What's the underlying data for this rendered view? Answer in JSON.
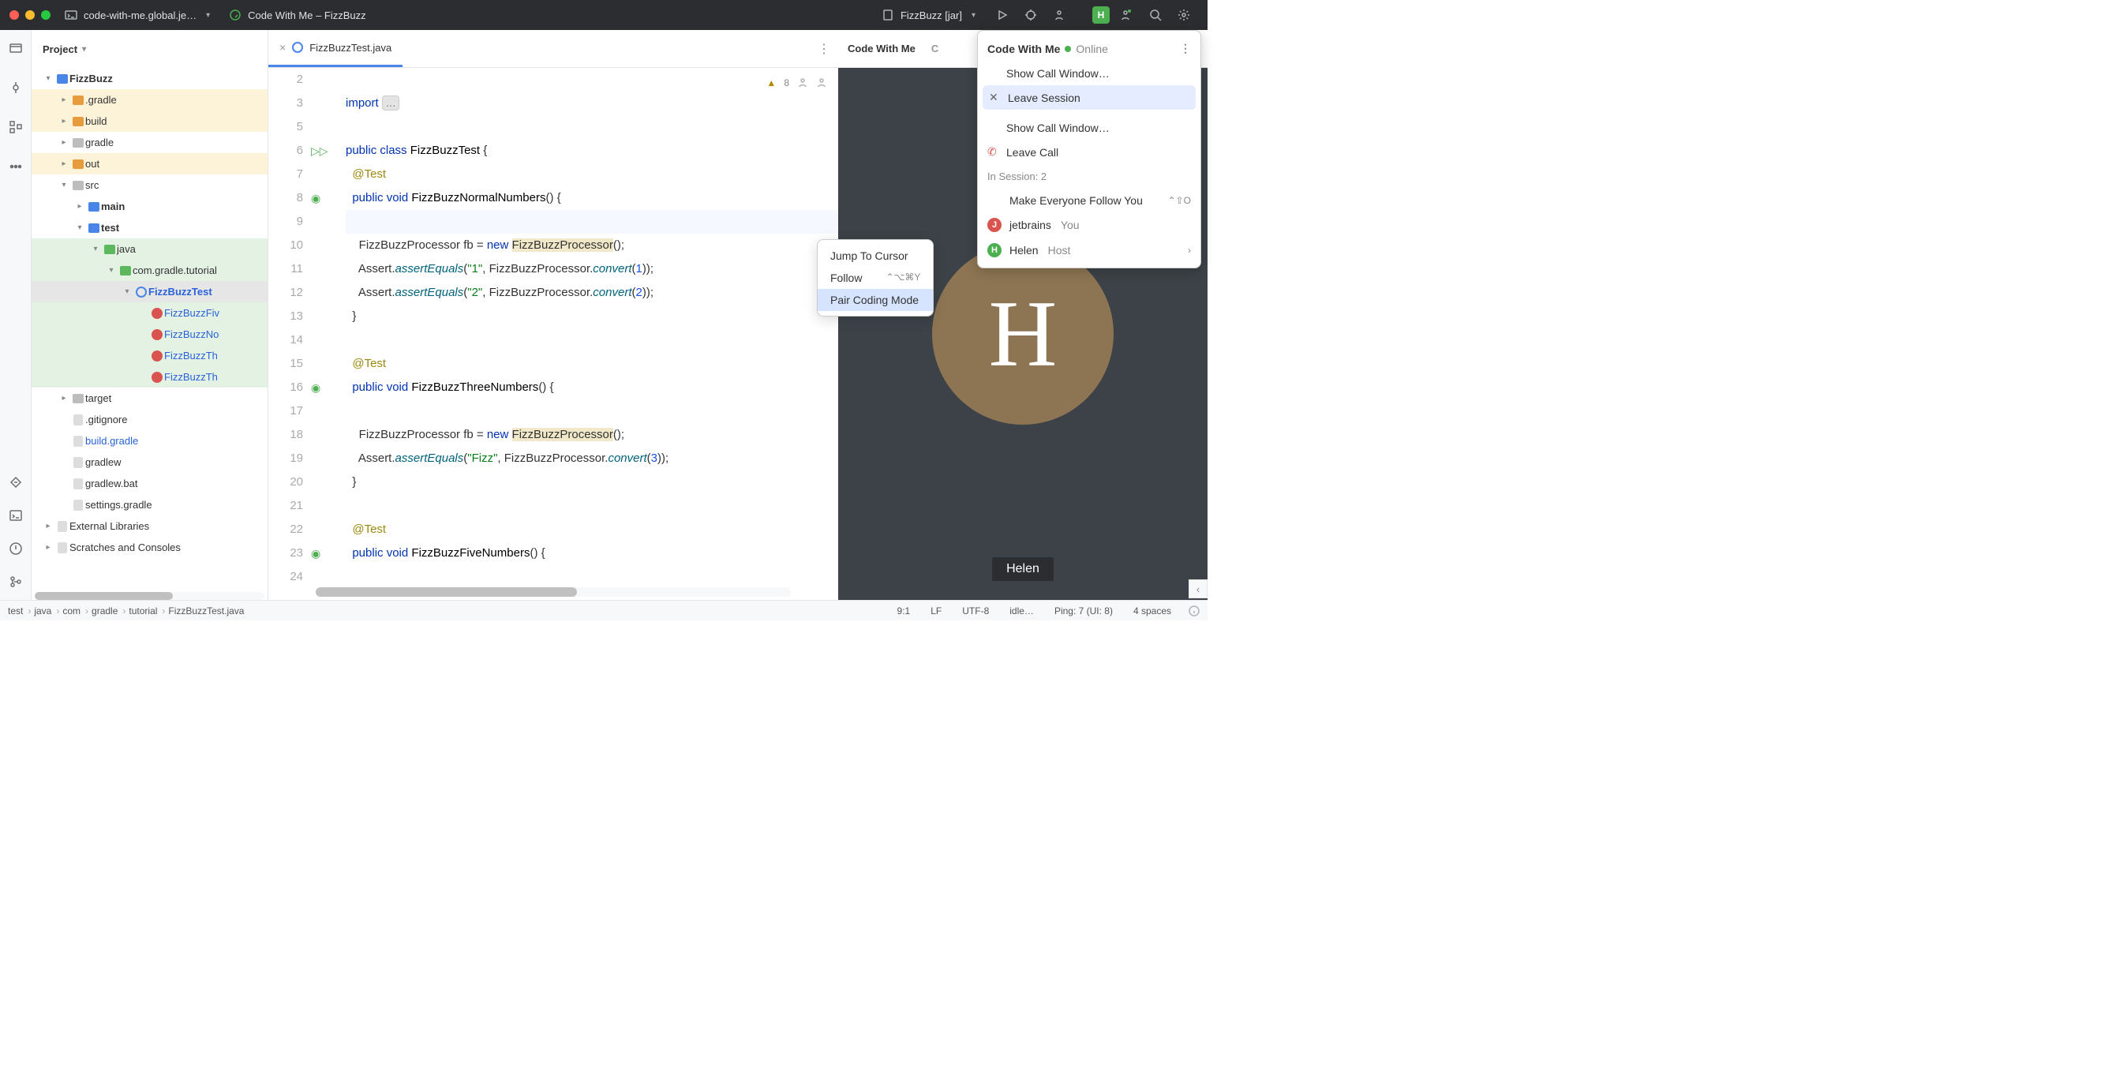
{
  "titlebar": {
    "project_file": "code-with-me.global.je…",
    "app_title": "Code With Me – FizzBuzz",
    "run_config": "FizzBuzz [jar]",
    "avatar_letter": "H"
  },
  "sidebar": {
    "title": "Project",
    "tree": [
      {
        "indent": 0,
        "chev": "▾",
        "icon": "folder blue",
        "label": "FizzBuzz",
        "bold": true,
        "hl": ""
      },
      {
        "indent": 1,
        "chev": "▸",
        "icon": "folder orange",
        "label": ".gradle",
        "hl": "hl-yellow"
      },
      {
        "indent": 1,
        "chev": "▸",
        "icon": "folder orange",
        "label": "build",
        "hl": "hl-yellow"
      },
      {
        "indent": 1,
        "chev": "▸",
        "icon": "folder grey",
        "label": "gradle",
        "hl": ""
      },
      {
        "indent": 1,
        "chev": "▸",
        "icon": "folder orange",
        "label": "out",
        "hl": "hl-yellow"
      },
      {
        "indent": 1,
        "chev": "▾",
        "icon": "folder grey",
        "label": "src",
        "hl": ""
      },
      {
        "indent": 2,
        "chev": "▸",
        "icon": "folder blue",
        "label": "main",
        "bold": true,
        "hl": ""
      },
      {
        "indent": 2,
        "chev": "▾",
        "icon": "folder blue",
        "label": "test",
        "bold": true,
        "hl": ""
      },
      {
        "indent": 3,
        "chev": "▾",
        "icon": "folder green",
        "label": "java",
        "hl": "hl-green"
      },
      {
        "indent": 4,
        "chev": "▾",
        "icon": "folder green",
        "label": "com.gradle.tutorial",
        "hl": "hl-green"
      },
      {
        "indent": 5,
        "chev": "▾",
        "icon": "circle",
        "label": "FizzBuzzTest",
        "bold": true,
        "blue": true,
        "hl": "sel"
      },
      {
        "indent": 6,
        "chev": "",
        "icon": "test",
        "label": "FizzBuzzFiv",
        "blue": true,
        "hl": "hl-green"
      },
      {
        "indent": 6,
        "chev": "",
        "icon": "test",
        "label": "FizzBuzzNo",
        "blue": true,
        "hl": "hl-green"
      },
      {
        "indent": 6,
        "chev": "",
        "icon": "test",
        "label": "FizzBuzzTh",
        "blue": true,
        "hl": "hl-green"
      },
      {
        "indent": 6,
        "chev": "",
        "icon": "test",
        "label": "FizzBuzzTh",
        "blue": true,
        "hl": "hl-green"
      },
      {
        "indent": 1,
        "chev": "▸",
        "icon": "folder grey",
        "label": "target",
        "hl": ""
      },
      {
        "indent": 1,
        "chev": "",
        "icon": "file",
        "label": ".gitignore",
        "hl": ""
      },
      {
        "indent": 1,
        "chev": "",
        "icon": "file",
        "label": "build.gradle",
        "blue": true,
        "hl": ""
      },
      {
        "indent": 1,
        "chev": "",
        "icon": "file",
        "label": "gradlew",
        "hl": ""
      },
      {
        "indent": 1,
        "chev": "",
        "icon": "file",
        "label": "gradlew.bat",
        "hl": ""
      },
      {
        "indent": 1,
        "chev": "",
        "icon": "file",
        "label": "settings.gradle",
        "hl": ""
      },
      {
        "indent": 0,
        "chev": "▸",
        "icon": "lib",
        "label": "External Libraries",
        "hl": ""
      },
      {
        "indent": 0,
        "chev": "▸",
        "icon": "scratch",
        "label": "Scratches and Consoles",
        "hl": ""
      }
    ]
  },
  "editor": {
    "tab_name": "FizzBuzzTest.java",
    "warnings": "8",
    "lines": [
      {
        "n": 2,
        "caret": false,
        "html": ""
      },
      {
        "n": 3,
        "caret": false,
        "html": "<span class='kw'>import</span> <span class='folded'>...</span>"
      },
      {
        "n": 5,
        "caret": false,
        "html": ""
      },
      {
        "n": 6,
        "caret": false,
        "gutter": "run",
        "html": "<span class='kw'>public</span> <span class='kw'>class</span> <span class='type'>FizzBuzzTest</span> {"
      },
      {
        "n": 7,
        "caret": false,
        "html": "  <span class='ann'>@Test</span>"
      },
      {
        "n": 8,
        "caret": false,
        "gutter": "cov",
        "html": "  <span class='kw'>public</span> <span class='kw'>void</span> <span class='type'>FizzBuzzNormalNumbers</span>() {"
      },
      {
        "n": 9,
        "caret": true,
        "html": ""
      },
      {
        "n": 10,
        "caret": false,
        "html": "    FizzBuzzProcessor <span class='grey'>fb</span> = <span class='kw'>new</span> <span class='hl'>FizzBuzzProcessor</span>();"
      },
      {
        "n": 11,
        "caret": false,
        "html": "    Assert.<span class='method'>assertEquals</span>(<span class='str'>\"1\"</span>, FizzBuzzProcessor.<span class='method'>convert</span>(<span class='num'>1</span>));"
      },
      {
        "n": 12,
        "caret": false,
        "html": "    Assert.<span class='method'>assertEquals</span>(<span class='str'>\"2\"</span>, FizzBuzzProcessor.<span class='method'>convert</span>(<span class='num'>2</span>));"
      },
      {
        "n": 13,
        "caret": false,
        "html": "  }"
      },
      {
        "n": 14,
        "caret": false,
        "html": ""
      },
      {
        "n": 15,
        "caret": false,
        "html": "  <span class='ann'>@Test</span>"
      },
      {
        "n": 16,
        "caret": false,
        "gutter": "cov",
        "html": "  <span class='kw'>public</span> <span class='kw'>void</span> <span class='type'>FizzBuzzThreeNumbers</span>() {"
      },
      {
        "n": 17,
        "caret": false,
        "html": ""
      },
      {
        "n": 18,
        "caret": false,
        "html": "    FizzBuzzProcessor <span class='grey'>fb</span> = <span class='kw'>new</span> <span class='hl'>FizzBuzzProcessor</span>();"
      },
      {
        "n": 19,
        "caret": false,
        "html": "    Assert.<span class='method'>assertEquals</span>(<span class='str'>\"Fizz\"</span>, FizzBuzzProcessor.<span class='method'>convert</span>(<span class='num'>3</span>));"
      },
      {
        "n": 20,
        "caret": false,
        "html": "  }"
      },
      {
        "n": 21,
        "caret": false,
        "html": ""
      },
      {
        "n": 22,
        "caret": false,
        "html": "  <span class='ann'>@Test</span>"
      },
      {
        "n": 23,
        "caret": false,
        "gutter": "cov",
        "html": "  <span class='kw'>public</span> <span class='kw'>void</span> <span class='type'>FizzBuzzFiveNumbers</span>() {"
      },
      {
        "n": 24,
        "caret": false,
        "html": ""
      }
    ]
  },
  "context_menu": {
    "items": [
      {
        "label": "Jump To Cursor",
        "short": ""
      },
      {
        "label": "Follow",
        "short": "⌃⌥⌘Y"
      },
      {
        "label": "Pair Coding Mode",
        "short": "",
        "sel": true
      }
    ]
  },
  "right": {
    "tabs": [
      "Code With Me",
      "C"
    ],
    "avatar_letter": "H",
    "name": "Helen"
  },
  "dropdown": {
    "title": "Code With Me",
    "status": "Online",
    "items1": [
      {
        "icon": "",
        "label": "Show Call Window…"
      },
      {
        "icon": "x",
        "label": "Leave Session",
        "sel": true
      }
    ],
    "items2": [
      {
        "icon": "",
        "label": "Show Call Window…"
      },
      {
        "icon": "phone",
        "label": "Leave Call"
      }
    ],
    "session_label": "In Session: 2",
    "make_follow": "Make Everyone Follow You",
    "make_follow_short": "⌃⇧O",
    "participants": [
      {
        "avatar": "J",
        "color": "j",
        "name": "jetbrains",
        "suffix": "You"
      },
      {
        "avatar": "H",
        "color": "h",
        "name": "Helen",
        "suffix": "Host",
        "chev": true
      }
    ]
  },
  "breadcrumbs": [
    "test",
    "java",
    "com",
    "gradle",
    "tutorial",
    "FizzBuzzTest.java"
  ],
  "statusbar": {
    "pos": "9:1",
    "sep": "LF",
    "enc": "UTF-8",
    "state": "idle…",
    "ping": "Ping: 7 (UI: 8)",
    "indent": "4 spaces"
  }
}
